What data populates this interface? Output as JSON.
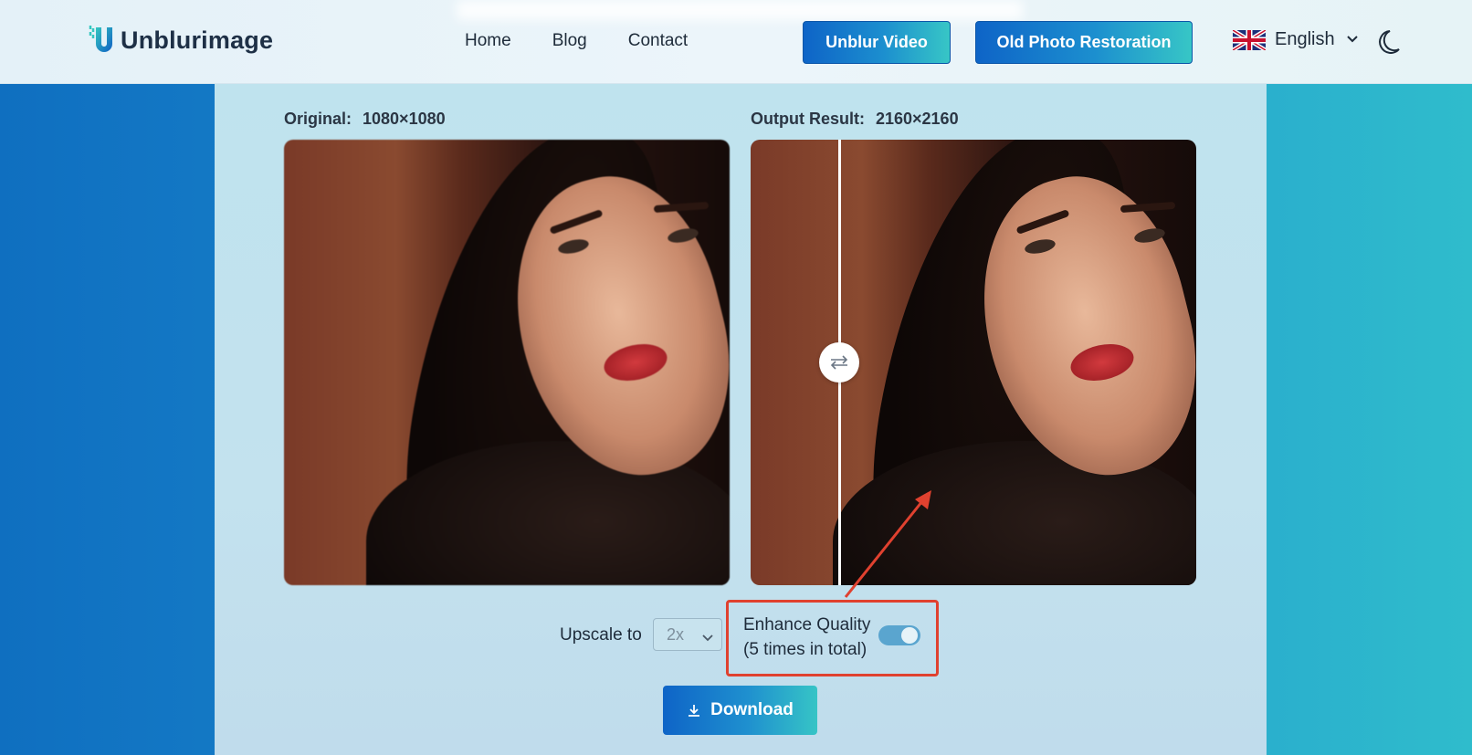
{
  "header": {
    "brand": "Unblurimage",
    "nav": [
      "Home",
      "Blog",
      "Contact"
    ],
    "btn_video": "Unblur Video",
    "btn_restore": "Old Photo Restoration",
    "language": "English"
  },
  "compare": {
    "original_label": "Original:",
    "original_size": "1080×1080",
    "output_label": "Output Result:",
    "output_size": "2160×2160"
  },
  "controls": {
    "upscale_label": "Upscale to",
    "upscale_value": "2x",
    "enhance_line1": "Enhance Quality",
    "enhance_line2": "(5 times in total)",
    "enhance_on": true,
    "download_label": "Download"
  },
  "colors": {
    "accent_start": "#0e64c7",
    "accent_end": "#36c4c6",
    "annotation": "#e0412f"
  }
}
